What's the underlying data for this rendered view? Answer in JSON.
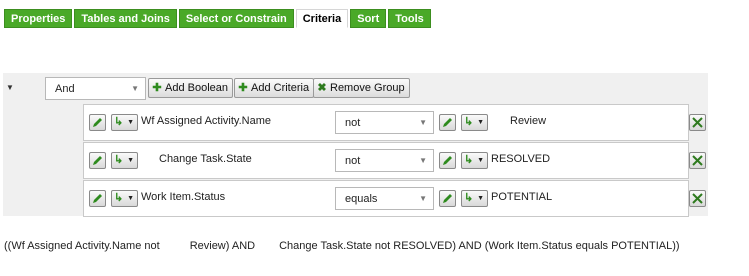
{
  "tabs": [
    {
      "label": "Properties",
      "active": false
    },
    {
      "label": "Tables and Joins",
      "active": false
    },
    {
      "label": "Select or Constrain",
      "active": false
    },
    {
      "label": "Criteria",
      "active": true
    },
    {
      "label": "Sort",
      "active": false
    },
    {
      "label": "Tools",
      "active": false
    }
  ],
  "group": {
    "operator": "And",
    "buttons": {
      "add_boolean": "Add Boolean",
      "add_criteria": "Add Criteria",
      "remove_group": "Remove Group"
    }
  },
  "criteria": [
    {
      "field": "Wf Assigned Activity.Name",
      "operator": "not",
      "value": "Review"
    },
    {
      "field": "Change Task.State",
      "operator": "not",
      "value": "RESOLVED"
    },
    {
      "field": "Work Item.Status",
      "operator": "equals",
      "value": "POTENTIAL"
    }
  ],
  "expression": {
    "p1": "((Wf Assigned Activity.Name not",
    "p2": "Review) AND",
    "p3": "Change Task.State not RESOLVED) AND (Work Item.Status equals POTENTIAL))"
  },
  "colors": {
    "tab_green": "#4aa928",
    "icon_green": "#2e8b1e",
    "panel_gray": "#f0f0f0"
  },
  "icons": [
    "triangle-down-icon",
    "plus-icon",
    "x-icon",
    "pencil-icon",
    "link-icon",
    "remove-icon",
    "dropdown-arrow-icon"
  ]
}
